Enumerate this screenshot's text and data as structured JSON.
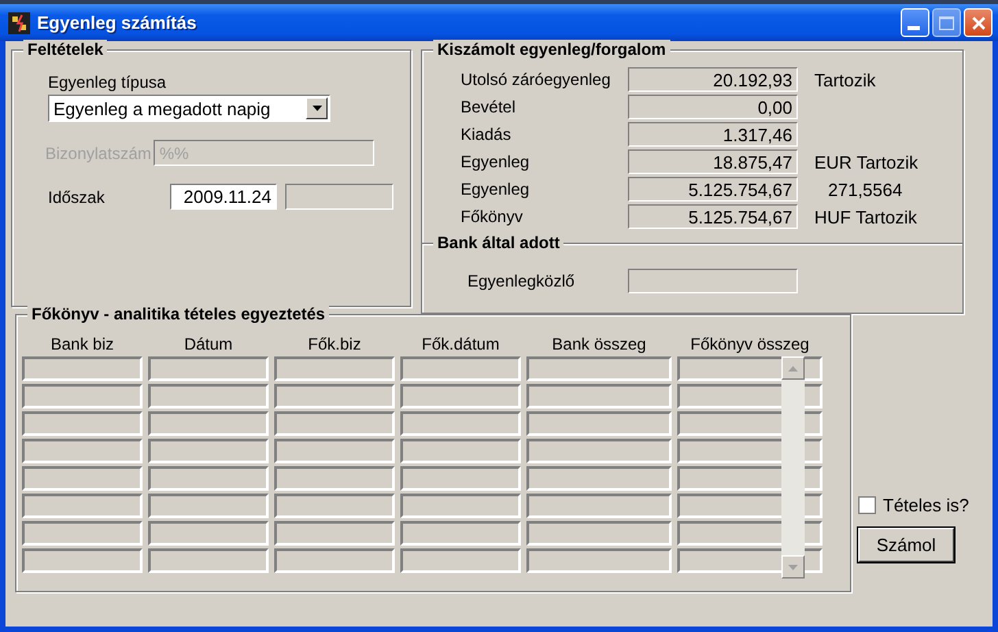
{
  "window": {
    "title": "Egyenleg számítás"
  },
  "conditions": {
    "title": "Feltételek",
    "balance_type": {
      "label": "Egyenleg típusa",
      "value": "Egyenleg a megadott napig"
    },
    "document_number": {
      "label": "Bizonylatszám",
      "value": "%%",
      "disabled": true
    },
    "period": {
      "label": "Időszak",
      "from": "2009.11.24"
    }
  },
  "computed": {
    "title": "Kiszámolt egyenleg/forgalom",
    "rows": [
      {
        "label": "Utolsó záróegyenleg",
        "value": "20.192,93",
        "note": "Tartozik"
      },
      {
        "label": "Bevétel",
        "value": "0,00"
      },
      {
        "label": "Kiadás",
        "value": "1.317,46"
      },
      {
        "label": "Egyenleg",
        "value": "18.875,47",
        "note": "EUR Tartozik"
      },
      {
        "label": "Egyenleg",
        "value": "5.125.754,67",
        "note": "271,5564"
      },
      {
        "label": "Főkönyv",
        "value": "5.125.754,67",
        "note": "HUF Tartozik"
      }
    ]
  },
  "bank": {
    "title": "Bank által adott",
    "fields": [
      {
        "label": "Egyenlegközlő"
      }
    ]
  },
  "reconciliation": {
    "title": "Főkönyv - analitika tételes egyeztetés",
    "columns": [
      "Bank biz",
      "Dátum",
      "Fők.biz",
      "Fők.dátum",
      "Bank összeg",
      "Főkönyv összeg"
    ]
  },
  "itemized": {
    "label": "Tételes is?",
    "checked": false
  },
  "buttons": [
    {
      "label": "Számol",
      "default": true
    }
  ]
}
